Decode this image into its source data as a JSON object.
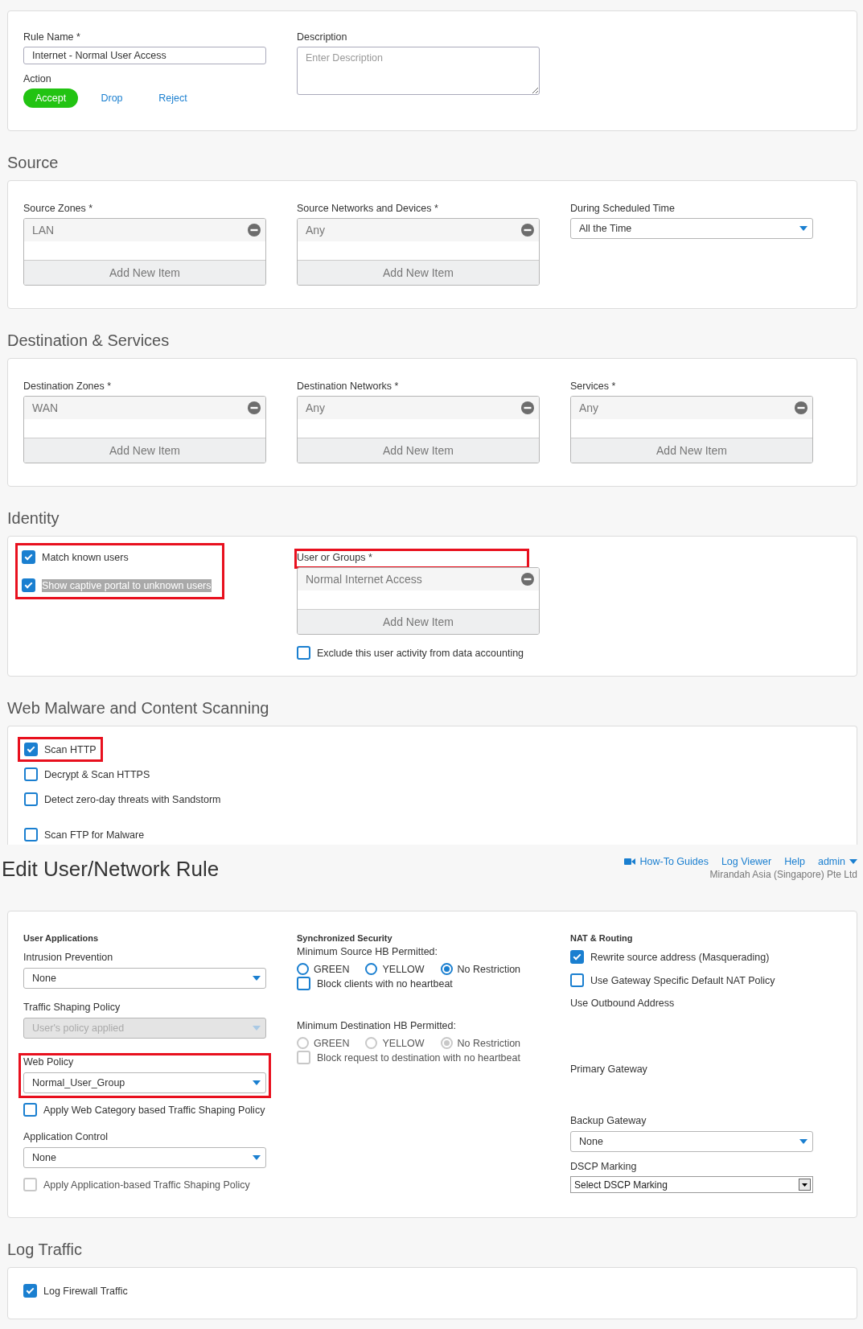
{
  "rule": {
    "name_label": "Rule Name *",
    "name_value": "Internet - Normal User Access",
    "description_label": "Description",
    "description_placeholder": "Enter Description",
    "action_label": "Action",
    "actions": [
      {
        "label": "Accept",
        "selected": true
      },
      {
        "label": "Drop",
        "selected": false
      },
      {
        "label": "Reject",
        "selected": false
      }
    ]
  },
  "source": {
    "title": "Source",
    "lists": [
      {
        "label": "Source Zones *",
        "items": [
          "LAN"
        ],
        "add_label": "Add New Item"
      },
      {
        "label": "Source Networks and Devices *",
        "items": [
          "Any"
        ],
        "add_label": "Add New Item"
      }
    ],
    "schedule": {
      "label": "During Scheduled Time",
      "value": "All the Time"
    }
  },
  "destination": {
    "title": "Destination & Services",
    "lists": [
      {
        "label": "Destination Zones *",
        "items": [
          "WAN"
        ],
        "add_label": "Add New Item"
      },
      {
        "label": "Destination Networks *",
        "items": [
          "Any"
        ],
        "add_label": "Add New Item"
      },
      {
        "label": "Services *",
        "items": [
          "Any"
        ],
        "add_label": "Add New Item"
      }
    ]
  },
  "identity": {
    "title": "Identity",
    "checks_highlighted": true,
    "checks": [
      {
        "label": "Match known users",
        "checked": true,
        "text_selected": false
      },
      {
        "label": "Show captive portal to unknown users",
        "checked": true,
        "text_selected": true
      }
    ],
    "user_groups": {
      "label": "User or Groups *",
      "highlighted": true,
      "items": [
        "Normal Internet Access"
      ],
      "add_label": "Add New Item"
    },
    "exclude": {
      "label": "Exclude this user activity from data accounting",
      "checked": false
    }
  },
  "scanning": {
    "title": "Web Malware and Content Scanning",
    "options": [
      {
        "label": "Scan HTTP",
        "checked": true,
        "highlighted": true
      },
      {
        "label": "Decrypt & Scan HTTPS",
        "checked": false,
        "highlighted": false
      },
      {
        "label": "Detect zero-day threats with Sandstorm",
        "checked": false,
        "highlighted": false
      }
    ],
    "ftp_options": [
      {
        "label": "Scan FTP for Malware",
        "checked": false
      }
    ]
  },
  "header": {
    "title": "Edit User/Network Rule",
    "links": [
      {
        "label": "How-To Guides",
        "kind": "video"
      },
      {
        "label": "Log Viewer",
        "kind": "plain"
      },
      {
        "label": "Help",
        "kind": "plain"
      },
      {
        "label": "admin",
        "kind": "menu"
      }
    ],
    "company": "Mirandah Asia (Singapore) Pte Ltd"
  },
  "user_applications": {
    "title": "User Applications",
    "fields": [
      {
        "kind": "select",
        "label": "Intrusion Prevention",
        "value": "None",
        "disabled": false,
        "highlighted": false
      },
      {
        "kind": "select",
        "label": "Traffic Shaping Policy",
        "value": "User's policy applied",
        "disabled": true,
        "highlighted": false
      },
      {
        "kind": "select",
        "label": "Web Policy",
        "value": "Normal_User_Group",
        "disabled": false,
        "highlighted": true
      },
      {
        "kind": "checkbox",
        "label": "Apply Web Category based Traffic Shaping Policy",
        "checked": false,
        "disabled": false
      },
      {
        "kind": "select",
        "label": "Application Control",
        "value": "None",
        "disabled": false,
        "highlighted": false
      },
      {
        "kind": "checkbox",
        "label": "Apply Application-based Traffic Shaping Policy",
        "checked": false,
        "disabled": true
      }
    ]
  },
  "synchronized_security": {
    "title": "Synchronized Security",
    "groups": [
      {
        "label": "Minimum Source HB Permitted:",
        "disabled": false,
        "options": [
          {
            "label": "GREEN",
            "selected": false
          },
          {
            "label": "YELLOW",
            "selected": false
          },
          {
            "label": "No Restriction",
            "selected": true
          }
        ],
        "block": {
          "label": "Block clients with no heartbeat",
          "checked": false
        }
      },
      {
        "label": "Minimum Destination HB Permitted:",
        "disabled": true,
        "options": [
          {
            "label": "GREEN",
            "selected": false
          },
          {
            "label": "YELLOW",
            "selected": false
          },
          {
            "label": "No Restriction",
            "selected": true
          }
        ],
        "block": {
          "label": "Block request to destination with no heartbeat",
          "checked": false
        }
      }
    ]
  },
  "nat_routing": {
    "title": "NAT & Routing",
    "checks": [
      {
        "label": "Rewrite source address (Masquerading)",
        "checked": true
      },
      {
        "label": "Use Gateway Specific Default NAT Policy",
        "checked": false
      }
    ],
    "outbound_label": "Use Outbound Address",
    "primary_label": "Primary Gateway",
    "backup": {
      "label": "Backup Gateway",
      "value": "None"
    },
    "dscp": {
      "label": "DSCP Marking",
      "value": "Select DSCP Marking"
    }
  },
  "log": {
    "title": "Log Traffic",
    "checks": [
      {
        "label": "Log Firewall Traffic",
        "checked": true
      }
    ]
  }
}
